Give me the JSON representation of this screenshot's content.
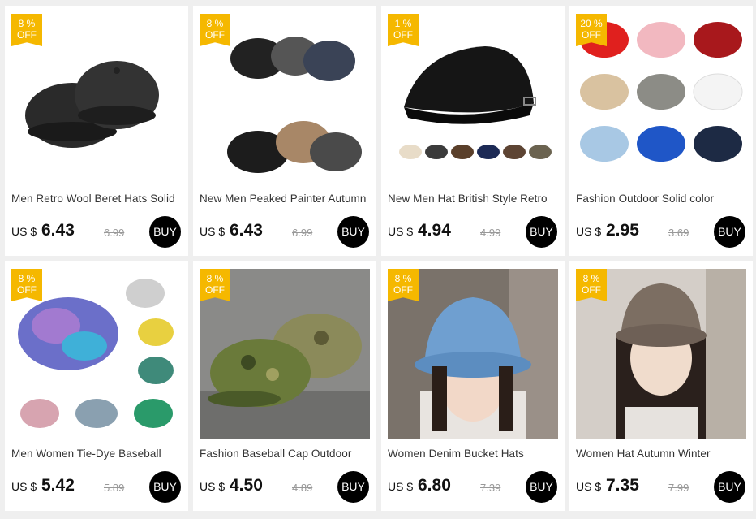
{
  "products": [
    {
      "badge_pct": "8 %",
      "badge_off": "OFF",
      "title": "Men Retro Wool Beret Hats Solid",
      "currency": "US $",
      "price": "6.43",
      "original": "6.99",
      "buy": "BUY"
    },
    {
      "badge_pct": "8 %",
      "badge_off": "OFF",
      "title": "New Men Peaked Painter Autumn",
      "currency": "US $",
      "price": "6.43",
      "original": "6.99",
      "buy": "BUY"
    },
    {
      "badge_pct": "1 %",
      "badge_off": "OFF",
      "title": "New Men Hat British Style Retro",
      "currency": "US $",
      "price": "4.94",
      "original": "4.99",
      "buy": "BUY"
    },
    {
      "badge_pct": "20 %",
      "badge_off": "OFF",
      "title": "Fashion Outdoor Solid color",
      "currency": "US $",
      "price": "2.95",
      "original": "3.69",
      "buy": "BUY"
    },
    {
      "badge_pct": "8 %",
      "badge_off": "OFF",
      "title": "Men Women Tie-Dye Baseball",
      "currency": "US $",
      "price": "5.42",
      "original": "5.89",
      "buy": "BUY"
    },
    {
      "badge_pct": "8 %",
      "badge_off": "OFF",
      "title": "Fashion Baseball Cap Outdoor",
      "currency": "US $",
      "price": "4.50",
      "original": "4.89",
      "buy": "BUY"
    },
    {
      "badge_pct": "8 %",
      "badge_off": "OFF",
      "title": "Women Denim Bucket Hats",
      "currency": "US $",
      "price": "6.80",
      "original": "7.39",
      "buy": "BUY"
    },
    {
      "badge_pct": "8 %",
      "badge_off": "OFF",
      "title": "Women Hat Autumn Winter",
      "currency": "US $",
      "price": "7.35",
      "original": "7.99",
      "buy": "BUY"
    }
  ],
  "colors": {
    "badge": "#f5b800",
    "buy_button": "#000000",
    "page_bg": "#efefef"
  }
}
